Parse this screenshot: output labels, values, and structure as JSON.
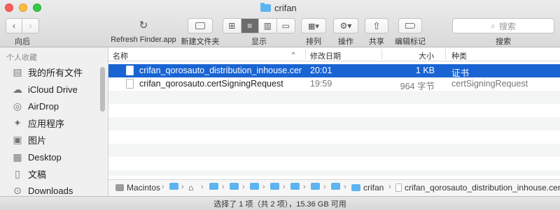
{
  "window": {
    "title": "crifan"
  },
  "toolbar": {
    "back_label": "向后",
    "refresh_label": "Refresh Finder.app",
    "new_folder_label": "新建文件夹",
    "view_label": "显示",
    "arrange_label": "排列",
    "action_label": "操作",
    "share_label": "共享",
    "tags_label": "编辑标记",
    "search_label": "搜索",
    "search_placeholder": "搜索"
  },
  "sidebar": {
    "heading": "个人收藏",
    "items": [
      {
        "label": "我的所有文件",
        "icon": "all-files-icon"
      },
      {
        "label": "iCloud Drive",
        "icon": "cloud-icon"
      },
      {
        "label": "AirDrop",
        "icon": "airdrop-icon"
      },
      {
        "label": "应用程序",
        "icon": "applications-icon"
      },
      {
        "label": "图片",
        "icon": "camera-icon"
      },
      {
        "label": "Desktop",
        "icon": "desktop-icon"
      },
      {
        "label": "文稿",
        "icon": "document-icon"
      },
      {
        "label": "Downloads",
        "icon": "downloads-icon"
      }
    ]
  },
  "file_list": {
    "columns": {
      "name": "名称",
      "date": "修改日期",
      "size": "大小",
      "kind": "种类"
    },
    "rows": [
      {
        "name": "crifan_qorosauto_distribution_inhouse.cer",
        "date": "20:01",
        "size": "1 KB",
        "kind": "证书",
        "selected": true
      },
      {
        "name": "crifan_qorosauto.certSigningRequest",
        "date": "19:59",
        "size": "964 字节",
        "kind": "certSigningRequest",
        "selected": false
      }
    ]
  },
  "path_bar": {
    "root": "Macintos",
    "current_folder": "crifan",
    "file": "crifan_qorosauto_distribution_inhouse.cer"
  },
  "status": {
    "text": "选择了 1 项（共 2 项），15.36 GB 可用"
  },
  "colors": {
    "selection": "#1964d2",
    "folder": "#5db4f0"
  }
}
